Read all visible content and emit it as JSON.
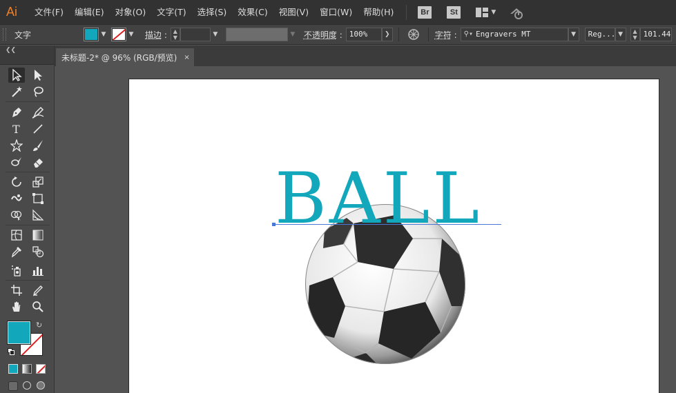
{
  "app": {
    "logo": "Ai"
  },
  "menu": [
    "文件(F)",
    "编辑(E)",
    "对象(O)",
    "文字(T)",
    "选择(S)",
    "效果(C)",
    "视图(V)",
    "窗口(W)",
    "帮助(H)"
  ],
  "bridge_buttons": [
    "Br",
    "St"
  ],
  "control_bar": {
    "object_type": "文字",
    "stroke_label": "描边",
    "opacity_label": "不透明度",
    "opacity_value": "100%",
    "character_label": "字符",
    "font_family": "Engravers MT",
    "font_style": "Reg...",
    "font_size": "101.44"
  },
  "document_tab": {
    "title": "未标题-2* @ 96% (RGB/预览)",
    "close": "×"
  },
  "canvas": {
    "text": "BALL",
    "text_color": "#12a7ba"
  },
  "colors": {
    "fill": "#12a7ba",
    "stroke": "none",
    "ui_bg": "#535353",
    "menubar": "#323232"
  },
  "icons": [
    "selection-icon",
    "direct-selection-icon",
    "magic-wand-icon",
    "lasso-icon",
    "pen-icon",
    "curvature-icon",
    "type-icon",
    "line-segment-icon",
    "star-icon",
    "paintbrush-icon",
    "blob-brush-icon",
    "eraser-icon",
    "rotate-icon",
    "scale-icon",
    "warp-icon",
    "free-transform-icon",
    "shape-builder-icon",
    "perspective-grid-icon",
    "mesh-icon",
    "gradient-icon",
    "eyedropper-icon",
    "blend-icon",
    "symbol-sprayer-icon",
    "column-graph-icon",
    "artboard-icon",
    "slice-icon",
    "hand-icon",
    "zoom-icon"
  ]
}
